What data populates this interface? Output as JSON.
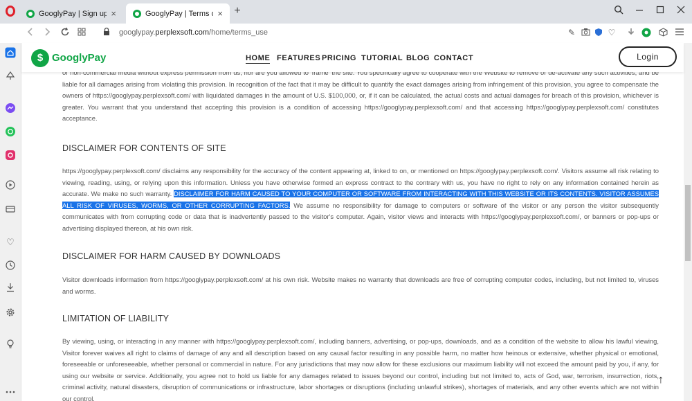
{
  "browser": {
    "tabs": [
      {
        "title": "GooglyPay | Sign up"
      },
      {
        "title": "GooglyPay | Terms of Use"
      }
    ],
    "tab_close_glyph": "×",
    "new_tab_glyph": "+",
    "url_prefix": "googlypay.",
    "url_domain": "perplexsoft.com",
    "url_path": "/home/terms_use"
  },
  "site": {
    "logo_mark": "$",
    "logo_text": "GooglyPay",
    "nav": [
      "HOME",
      "FEATURES",
      "PRICING",
      "TUTORIAL",
      "BLOG",
      "CONTACT"
    ],
    "login_label": "Login",
    "brand_color": "#10a546"
  },
  "content": {
    "intro_paragraph": "or non-commercial media without express permission from us, nor are you allowed to 'frame' the site. You specifically agree to cooperate with the Website to remove or de-activate any such activities, and be liable for all damages arising from violating this provision. In recognition of the fact that it may be difficult to quantify the exact damages arising from infringement of this provision, you agree to compensate the owners of https://googlypay.perplexsoft.com/ with liquidated damages in the amount of U.S. $100,000, or, if it can be calculated, the actual costs and actual damages for breach of this provision, whichever is greater. You warrant that you understand that accepting this provision is a condition of accessing https://googlypay.perplexsoft.com/ and that accessing https://googlypay.perplexsoft.com/ constitutes acceptance.",
    "disclaimer_contents": {
      "heading": "DISCLAIMER FOR CONTENTS OF SITE",
      "text_before": "https://googlypay.perplexsoft.com/ disclaims any responsibility for the accuracy of the content appearing at, linked to on, or mentioned on https://googlypay.perplexsoft.com/. Visitors assume all risk relating to viewing, reading, using, or relying upon this information. Unless you have otherwise formed an express contract to the contrary with us, you have no right to rely on any information contained herein as accurate. We make no such warranty. ",
      "text_highlighted": "DISCLAIMER FOR HARM CAUSED TO YOUR COMPUTER OR SOFTWARE FROM INTERACTING WITH THIS WEBSITE OR ITS CONTENTS. VISITOR ASSUMES ALL RISK OF VIRUSES, WORMS, OR OTHER CORRUPTING FACTORS.",
      "text_after": " We assume no responsibility for damage to computers or software of the visitor or any person the visitor subsequently communicates with from corrupting code or data that is inadvertently passed to the visitor's computer. Again, visitor views and interacts with https://googlypay.perplexsoft.com/, or banners or pop-ups or advertising displayed thereon, at his own risk."
    },
    "disclaimer_downloads": {
      "heading": "DISCLAIMER FOR HARM CAUSED BY DOWNLOADS",
      "text": "Visitor downloads information from https://googlypay.perplexsoft.com/ at his own risk. Website makes no warranty that downloads are free of corrupting computer codes, including, but not limited to, viruses and worms."
    },
    "limitation": {
      "heading": "LIMITATION OF LIABILITY",
      "text": "By viewing, using, or interacting in any manner with https://googlypay.perplexsoft.com/, including banners, advertising, or pop-ups, downloads, and as a condition of the website to allow his lawful viewing, Visitor forever waives all right to claims of damage of any and all description based on any causal factor resulting in any possible harm, no matter how heinous or extensive, whether physical or emotional, foreseeable or unforeseeable, whether personal or commercial in nature. For any jurisdictions that may now allow for these exclusions our maximum liability will not exceed the amount paid by you, if any, for using our website or service. Additionally, you agree not to hold us liable for any damages related to issues beyond our control, including but not limited to, acts of God, war, terrorism, insurrection, riots, criminal activity, natural disasters, disruption of communications or infrastructure, labor shortages or disruptions (including unlawful strikes), shortages of materials, and any other events which are not within our control."
    },
    "back_to_top_glyph": "↑"
  }
}
